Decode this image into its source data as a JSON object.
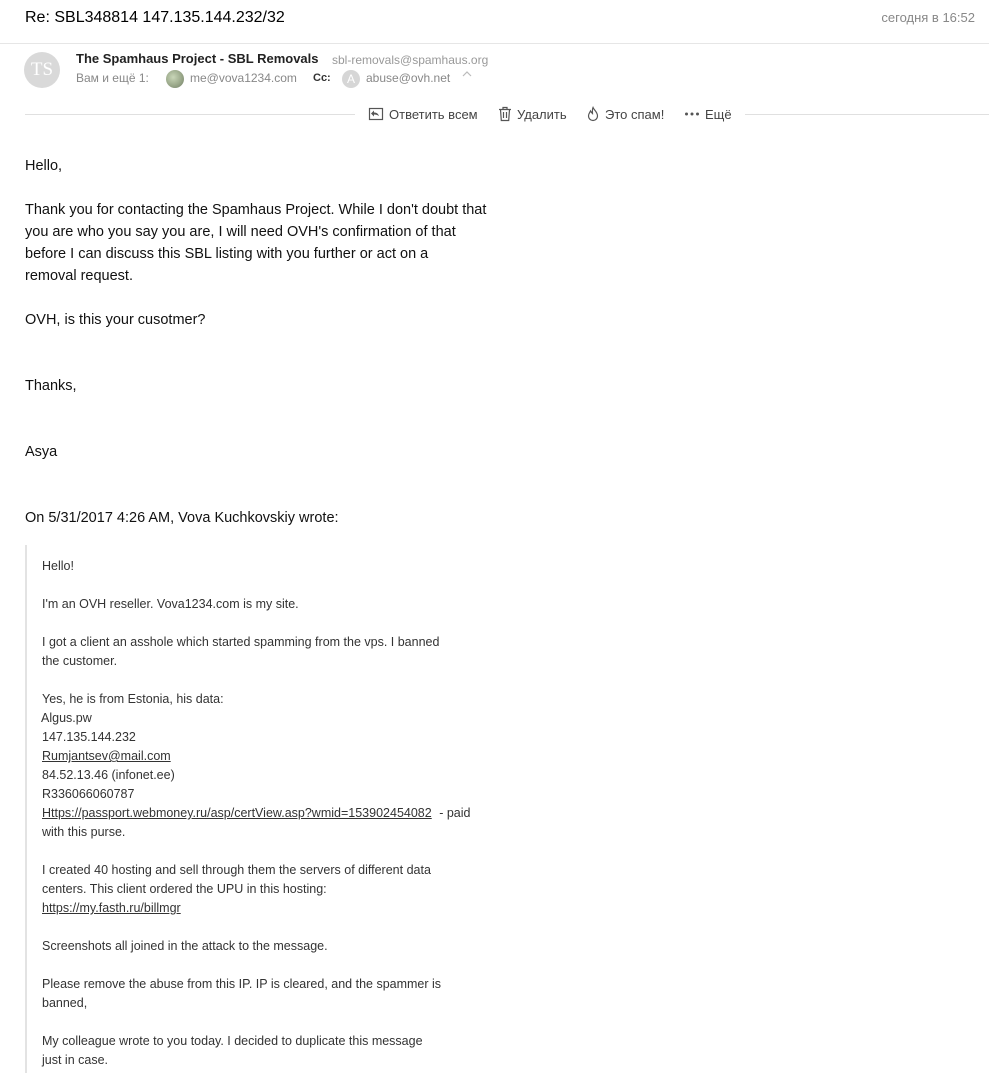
{
  "header": {
    "subject": "Re: SBL348814 147.135.144.232/32",
    "date": "сегодня в 16:52"
  },
  "sender": {
    "initials": "TS",
    "name": "The Spamhaus Project - SBL Removals",
    "email": "sbl-removals@spamhaus.org"
  },
  "recipients": {
    "to_label": "Вам и ещё 1:",
    "to_email": "me@vova1234.com",
    "cc_label": "Cc:",
    "cc_initial": "A",
    "cc_email": "abuse@ovh.net"
  },
  "toolbar": {
    "reply_all": "Ответить всем",
    "delete": "Удалить",
    "spam": "Это спам!",
    "more": "Ещё"
  },
  "body": {
    "greeting": "Hello,",
    "para1_l1": "Thank you for contacting the Spamhaus Project.  While I don't doubt that",
    "para1_l2": "you are who you say you are, I will need OVH's confirmation of that",
    "para1_l3": "before I can discuss this SBL listing with you further or act on a",
    "para1_l4": "removal request.",
    "para2": "OVH, is this your cusotmer?",
    "thanks": "Thanks,",
    "signature": "Asya",
    "quote_header": "On 5/31/2017 4:26 AM, Vova Kuchkovskiy wrote:"
  },
  "quote": {
    "hello": "Hello!",
    "reseller": "I'm an OVH reseller. Vova1234.com is my site.",
    "client_l1": "I got a client an asshole which started spamming from the vps. I banned",
    "client_l2": "the customer.",
    "data_intro": "Yes, he is from Estonia, his data:",
    "data_domain": "Algus.pw",
    "data_ip": "147.135.144.232",
    "data_email": "Rumjantsev@mail.com",
    "data_ip2": "84.52.13.46 (infonet.ee)",
    "data_purse": "R336066060787",
    "data_link": "Https://passport.webmoney.ru/asp/certView.asp?wmid=153902454082",
    "data_link_suffix": " - paid",
    "data_link_suffix2": "with this purse.",
    "hosting_l1": "I created 40 hosting and sell through them the servers of different data",
    "hosting_l2": "centers. This client ordered the UPU in this hosting:",
    "hosting_link": "https://my.fasth.ru/billmgr",
    "screenshots": "Screenshots all joined in the attack to the message.",
    "remove_l1": "Please remove the abuse from this IP. IP is cleared, and the spammer is",
    "remove_l2": "banned,",
    "colleague_l1": "My colleague wrote to you today. I decided to duplicate this message",
    "colleague_l2": "just in case."
  }
}
